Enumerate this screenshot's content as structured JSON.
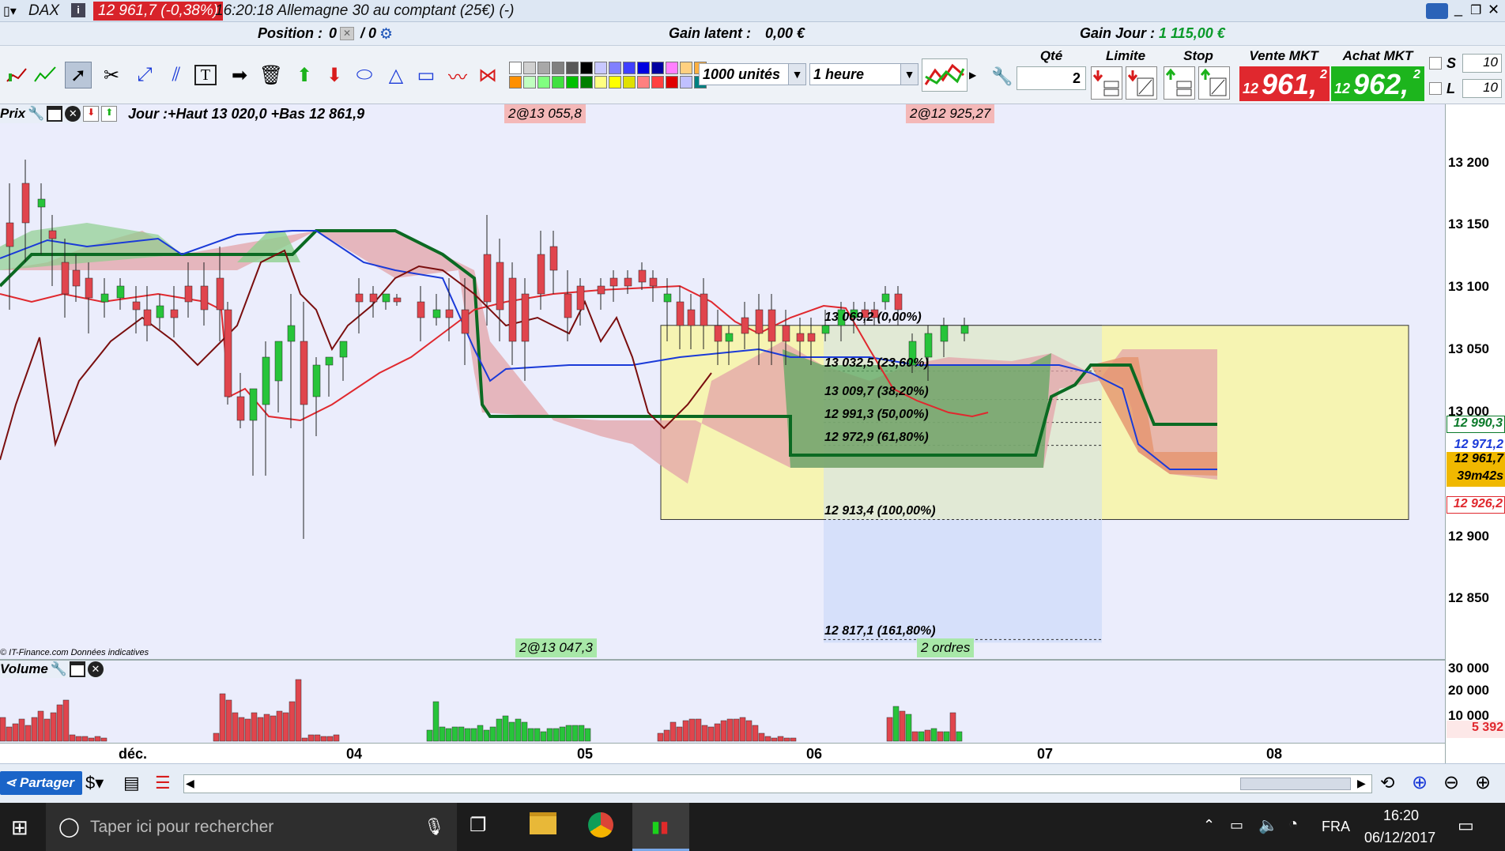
{
  "titlebar": {
    "symbol": "DAX",
    "info_icon": "info-icon",
    "price_change": "12 961,7 (-0,38%)",
    "title": "16:20:18 Allemagne 30 au comptant (25€) (-)"
  },
  "position_bar": {
    "position_label": "Position :",
    "position_value": "0",
    "position_sep": "/ 0",
    "gain_latent_label": "Gain latent :",
    "gain_latent_value": "0,00 €",
    "gain_jour_label": "Gain Jour :",
    "gain_jour_value": "1 115,00 €"
  },
  "toolbar": {
    "units_value": "1000 unités",
    "period_value": "1 heure",
    "qty_label": "Qté",
    "qty_value": "2",
    "limit_label": "Limite",
    "stop_label": "Stop",
    "sell_label": "Vente MKT",
    "sell_prefix": "12",
    "sell_big": "961,",
    "sell_sup": "2",
    "buy_label": "Achat MKT",
    "buy_prefix": "12",
    "buy_big": "962,",
    "buy_sup": "2",
    "s_label": "S",
    "s_value": "10",
    "l_label": "L",
    "l_value": "10",
    "palette_colors": [
      "#ffffff",
      "#d0d0d0",
      "#a8a8a8",
      "#808080",
      "#585858",
      "#000000",
      "#c8c8ff",
      "#8080ff",
      "#4040ff",
      "#0000e0",
      "#0000a0",
      "#ff80ff",
      "#ffd080",
      "#ffb040",
      "#ff9000",
      "#c0ffc0",
      "#80ff80",
      "#40e040",
      "#00c000",
      "#008000",
      "#ffff80",
      "#ffff00",
      "#e0e000",
      "#ff8080",
      "#ff4040",
      "#e00000",
      "#c0c0ff",
      "#008080"
    ]
  },
  "price_panel": {
    "label": "Prix",
    "day_info": "Jour :+Haut 13 020,0 +Bas 12 861,9",
    "order_tag_1": "2@13 055,8",
    "order_tag_2": "2@12 925,27",
    "order_tag_3": "2@13 047,3",
    "orders_tag": "2 ordres",
    "copyright": "© IT-Finance.com  Données indicatives",
    "fib_levels": [
      {
        "label": "13 069,2 (0,00%)",
        "price": 13069.2
      },
      {
        "label": "13 032,5 (23,60%)",
        "price": 13032.5
      },
      {
        "label": "13 009,7 (38,20%)",
        "price": 13009.7
      },
      {
        "label": "12 991,3 (50,00%)",
        "price": 12991.3
      },
      {
        "label": "12 972,9 (61,80%)",
        "price": 12972.9
      },
      {
        "label": "12 913,4 (100,00%)",
        "price": 12913.4
      },
      {
        "label": "12 817,1 (161,80%)",
        "price": 12817.1
      }
    ]
  },
  "price_axis": {
    "ticks": [
      {
        "label": "13 200",
        "price": 13200
      },
      {
        "label": "13 150",
        "price": 13150
      },
      {
        "label": "13 100",
        "price": 13100
      },
      {
        "label": "13 050",
        "price": 13050
      },
      {
        "label": "13 000",
        "price": 13000
      },
      {
        "label": "12 900",
        "price": 12900
      },
      {
        "label": "12 850",
        "price": 12850
      }
    ],
    "markers": {
      "green": "12 990,3",
      "blue": "12 971,2",
      "last": "12 961,7",
      "timer": "39m42s",
      "red": "12 926,2"
    },
    "colors": {
      "green": "#0b7a2a",
      "blue": "#1a3ad8",
      "last": "#f0b800",
      "red": "#e0282e"
    }
  },
  "volume_panel": {
    "label": "Volume",
    "ticks": [
      "30 000",
      "20 000",
      "10 000"
    ],
    "last_volume": "5 392"
  },
  "date_axis": {
    "labels": [
      "déc.",
      "04",
      "05",
      "06",
      "07",
      "08"
    ]
  },
  "bottom_bar": {
    "share_label": "Partager"
  },
  "taskbar": {
    "search_placeholder": "Taper ici pour rechercher",
    "lang": "FRA",
    "time": "16:20",
    "date": "06/12/2017"
  },
  "chart_data": {
    "type": "candlestick",
    "ylim": [
      12810,
      13225
    ],
    "x_labels": [
      "déc.",
      "04",
      "05",
      "06",
      "07",
      "08"
    ],
    "note_levels": [
      13069.2,
      13032.5,
      13009.7,
      12991.3,
      12972.9,
      12913.4,
      12817.1
    ]
  }
}
